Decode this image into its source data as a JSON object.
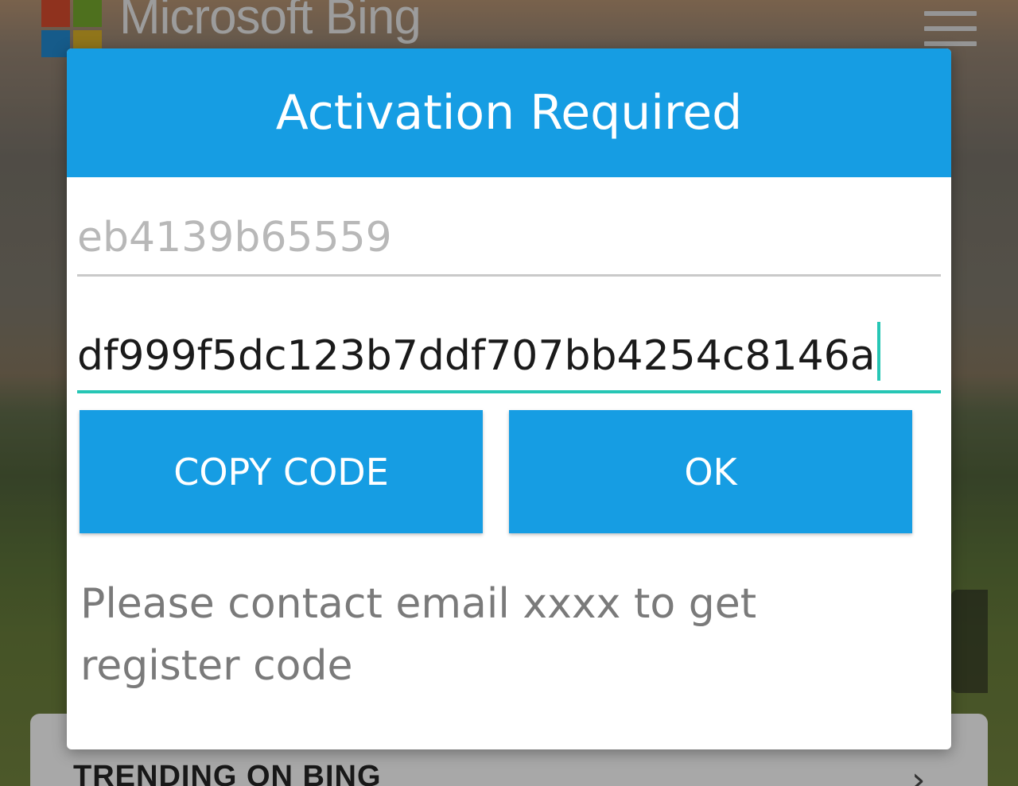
{
  "background": {
    "brand_text": "Microsoft Bing",
    "trending_label": "TRENDING ON BING",
    "trending_chevron": "›"
  },
  "dialog": {
    "title": "Activation Required",
    "device_id_field": {
      "value": "eb4139b65559"
    },
    "register_code_field": {
      "value": "df999f5dc123b7ddf707bb4254c8146a"
    },
    "buttons": {
      "copy_code": "COPY CODE",
      "ok": "OK"
    },
    "message": "Please contact email xxxx to get register code"
  },
  "colors": {
    "accent": "#169de3",
    "focus_underline": "#26c6b5",
    "message_text": "#7a7a7a",
    "device_id_text": "#b8b8b8"
  },
  "icons": [
    "microsoft-logo-icon",
    "hamburger-menu-icon",
    "chevron-right-icon"
  ]
}
